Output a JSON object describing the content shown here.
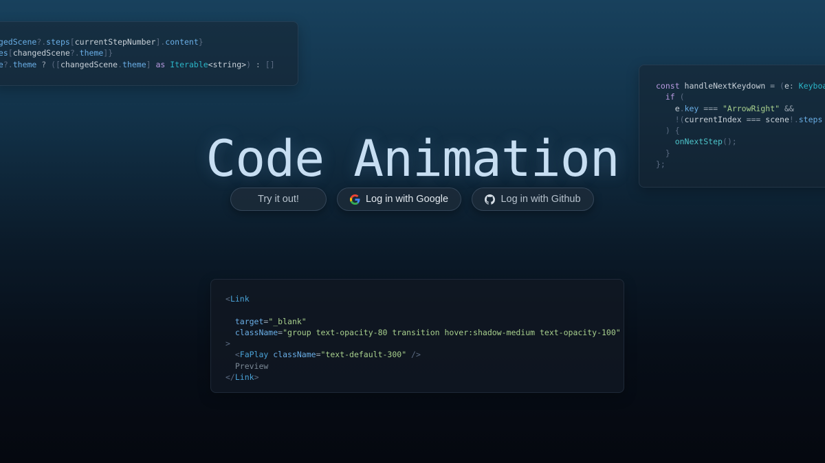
{
  "hero": {
    "title": "Code Animation"
  },
  "buttons": {
    "try": "Try it out!",
    "google": "Log in with Google",
    "github": "Log in with Github"
  },
  "icons": {
    "google": "google-icon",
    "github": "github-icon"
  },
  "code_top_left": [
    [
      [
        "t-prop",
        "ngedScene"
      ],
      [
        "t-punct",
        "?."
      ],
      [
        "t-prop",
        "steps"
      ],
      [
        "t-punct",
        "["
      ],
      [
        "t-default",
        "currentStepNumber"
      ],
      [
        "t-punct",
        "]."
      ],
      [
        "t-prop",
        "content"
      ],
      [
        "t-punct",
        "}"
      ]
    ],
    [
      [
        "t-prop",
        "mes"
      ],
      [
        "t-punct",
        "["
      ],
      [
        "t-default",
        "changedScene"
      ],
      [
        "t-punct",
        "?."
      ],
      [
        "t-prop",
        "theme"
      ],
      [
        "t-punct",
        "]}"
      ]
    ],
    [
      [
        "t-prop",
        "ne"
      ],
      [
        "t-punct",
        "?."
      ],
      [
        "t-prop",
        "theme"
      ],
      [
        "t-op",
        " ? "
      ],
      [
        "t-punct",
        "(["
      ],
      [
        "t-default",
        "changedScene"
      ],
      [
        "t-punct",
        "."
      ],
      [
        "t-prop",
        "theme"
      ],
      [
        "t-punct",
        "]"
      ],
      [
        "t-kw",
        " as "
      ],
      [
        "t-type",
        "Iterable"
      ],
      [
        "t-default",
        "<string>"
      ],
      [
        "t-punct",
        ")"
      ],
      [
        "t-op",
        " : "
      ],
      [
        "t-punct",
        "[]"
      ]
    ]
  ],
  "code_right": [
    [
      [
        "t-kw",
        "const "
      ],
      [
        "t-default",
        "handleNextKeydown "
      ],
      [
        "t-op",
        "= "
      ],
      [
        "t-punct",
        "("
      ],
      [
        "t-default",
        "e"
      ],
      [
        "t-op",
        ": "
      ],
      [
        "t-type",
        "KeyboardEvent"
      ]
    ],
    [
      [
        "t-kw",
        "  if "
      ],
      [
        "t-punct",
        "("
      ]
    ],
    [
      [
        "t-default",
        "    e"
      ],
      [
        "t-punct",
        "."
      ],
      [
        "t-prop",
        "key"
      ],
      [
        "t-op",
        " === "
      ],
      [
        "t-str",
        "\"ArrowRight\""
      ],
      [
        "t-op",
        " &&"
      ]
    ],
    [
      [
        "t-punct",
        "    !("
      ],
      [
        "t-default",
        "currentIndex "
      ],
      [
        "t-op",
        "=== "
      ],
      [
        "t-default",
        "scene"
      ],
      [
        "t-punct",
        "!."
      ],
      [
        "t-prop",
        "steps"
      ]
    ],
    [
      [
        "t-punct",
        "  ) {"
      ]
    ],
    [
      [
        "t-fn",
        "    onNextStep"
      ],
      [
        "t-punct",
        "();"
      ]
    ],
    [
      [
        "t-punct",
        "  }"
      ]
    ],
    [
      [
        "t-punct",
        "};"
      ]
    ]
  ],
  "code_center": [
    [
      [
        "t-punct",
        "<"
      ],
      [
        "t-tag",
        "Link"
      ]
    ],
    [],
    [
      [
        "t-attr",
        "  target"
      ],
      [
        "t-op",
        "="
      ],
      [
        "t-str",
        "\"_blank\""
      ]
    ],
    [
      [
        "t-attr",
        "  className"
      ],
      [
        "t-op",
        "="
      ],
      [
        "t-str",
        "\"group text-opacity-80 transition hover:shadow-medium text-opacity-100\""
      ]
    ],
    [
      [
        "t-punct",
        ">"
      ]
    ],
    [
      [
        "t-punct",
        "  <"
      ],
      [
        "t-tag",
        "FaPlay "
      ],
      [
        "t-attr",
        "className"
      ],
      [
        "t-op",
        "="
      ],
      [
        "t-str",
        "\"text-default-300\""
      ],
      [
        "t-punct",
        " />"
      ]
    ],
    [
      [
        "t-muted",
        "  Preview"
      ]
    ],
    [
      [
        "t-punct",
        "</"
      ],
      [
        "t-tag",
        "Link"
      ],
      [
        "t-punct",
        ">"
      ]
    ]
  ],
  "colors": {
    "google_blue": "#4285F4",
    "google_red": "#EA4335",
    "google_yellow": "#FBBC05",
    "google_green": "#34A853",
    "title": "#c7def2"
  }
}
